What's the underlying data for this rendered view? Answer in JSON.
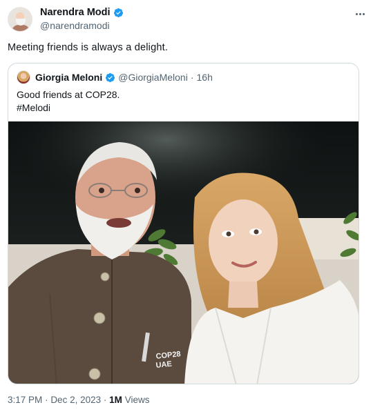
{
  "author": {
    "display_name": "Narendra Modi",
    "handle": "@narendramodi"
  },
  "tweet": {
    "text": "Meeting friends is always a delight."
  },
  "quoted": {
    "display_name": "Giorgia Meloni",
    "handle": "@GiorgiaMeloni",
    "separator": "·",
    "time": "16h",
    "line1": "Good friends at COP28.",
    "line2": "#Melodi"
  },
  "photo": {
    "pocket_text_1": "COP28",
    "pocket_text_2": "UAE"
  },
  "meta": {
    "time": "3:17 PM",
    "separator": "·",
    "date": "Dec 2, 2023",
    "views_count": "1M",
    "views_label": "Views"
  },
  "colors": {
    "verified_blue": "#1d9bf0",
    "text_primary": "#0f1419",
    "text_secondary": "#536471",
    "border": "#cfd9de"
  },
  "icons": [
    "verified-badge-icon",
    "more-options-icon"
  ]
}
